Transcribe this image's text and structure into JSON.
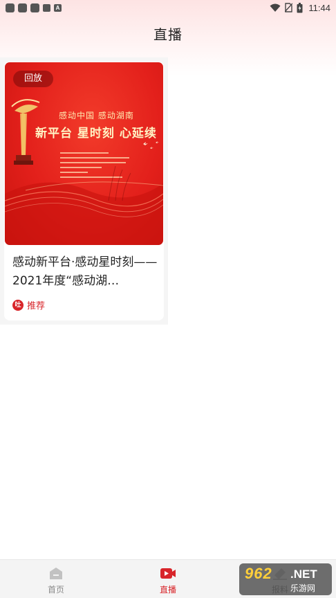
{
  "status_bar": {
    "time": "11:44",
    "notification_icons": [
      "app-icon",
      "app-icon",
      "app-icon",
      "app-icon",
      "a-icon"
    ],
    "right_icons": [
      "wifi-icon",
      "no-sim-icon",
      "battery-icon"
    ]
  },
  "header": {
    "title": "直播"
  },
  "cards": [
    {
      "badge": "回放",
      "poster_subtitle": "感动中国  感动湖南",
      "poster_title": "新平台 星时刻 心延续",
      "title": "感动新平台·感动星时刻——2021年度“感动湖…",
      "tag_icon_text": "吐",
      "tag": "推荐"
    }
  ],
  "bottom_nav": {
    "items": [
      {
        "label": "首页",
        "icon": "home-icon",
        "active": false
      },
      {
        "label": "直播",
        "icon": "live-camera-icon",
        "active": true
      },
      {
        "label": "报料",
        "icon": "report-icon",
        "active": false
      }
    ]
  },
  "watermark": {
    "main": "962",
    "net": ".NET",
    "sub": "乐游网"
  },
  "colors": {
    "accent": "#d8252a",
    "inactive": "#8a8a8a",
    "poster_red": "#e3201b"
  }
}
